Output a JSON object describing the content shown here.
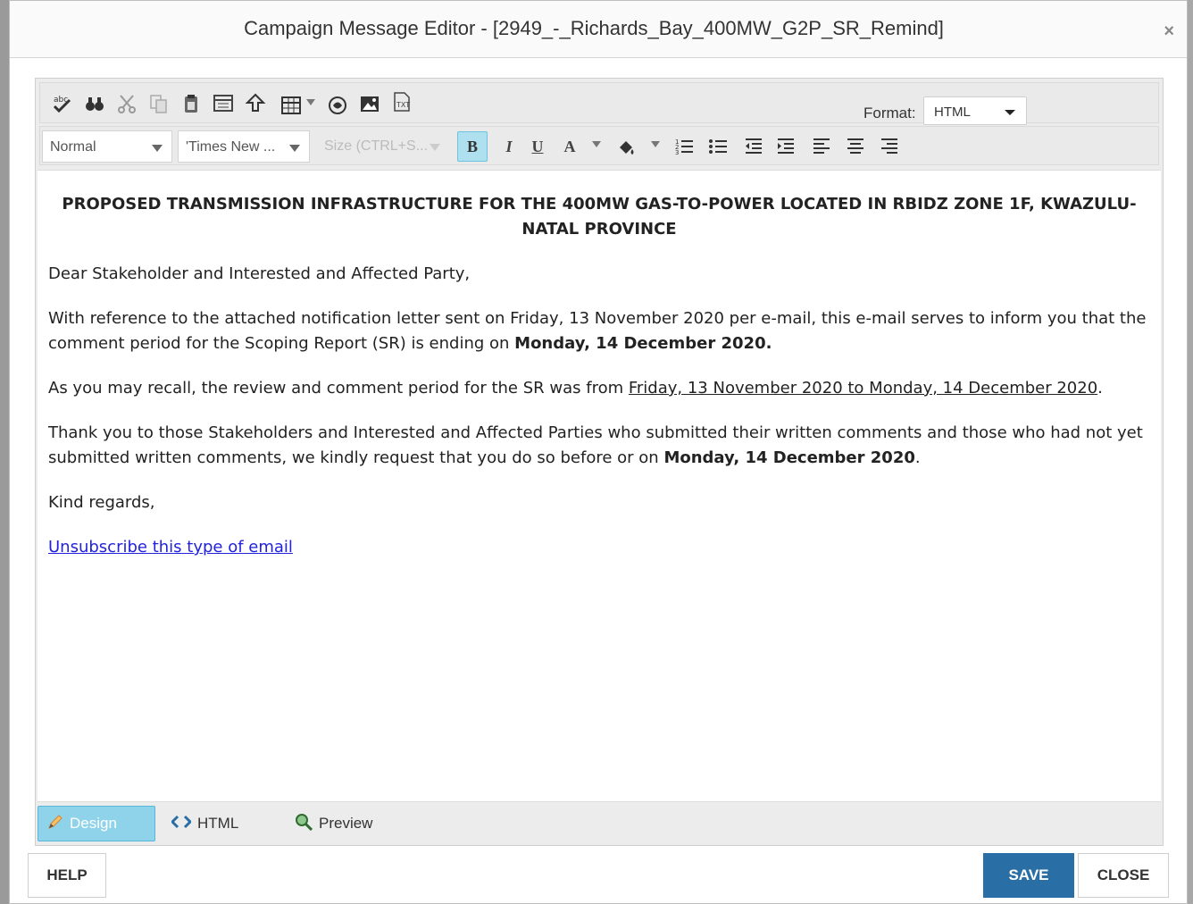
{
  "dialog": {
    "title": "Campaign Message Editor - [2949_-_Richards_Bay_400MW_G2P_SR_Remind]",
    "close_glyph": "×"
  },
  "toolbar": {
    "icons_row1": [
      "spellcheck-icon",
      "find-icon",
      "cut-icon",
      "copy-icon",
      "paste-icon",
      "template-icon",
      "insert-symbol-icon",
      "table-icon",
      "table-dropdown-icon",
      "link-icon",
      "image-icon",
      "document-icon"
    ],
    "format_label": "Format:",
    "format_value": "HTML",
    "paragraph_style": "Normal",
    "font_name": "'Times New ...",
    "font_size": "Size (CTRL+S...",
    "bold": "B",
    "italic": "I",
    "underline": "U",
    "font_color": "A",
    "highlight": "⟴"
  },
  "content": {
    "heading": "PROPOSED TRANSMISSION INFRASTRUCTURE FOR THE 400MW GAS-TO-POWER LOCATED IN RBIDZ ZONE 1F, KWAZULU-NATAL PROVINCE",
    "greeting": "Dear Stakeholder and Interested and Affected Party,",
    "p1_text": "With reference to the attached notification letter sent on Friday, 13 November 2020 per e-mail, this e-mail serves to inform you that the comment period for the Scoping Report (SR) is ending on ",
    "p1_bold": "Monday, 14 December 2020.",
    "p2_text": "As you may recall, the review and comment period for the SR was from ",
    "p2_underlined": "Friday, 13 November 2020 to Monday, 14 December 2020",
    "p2_end": ".",
    "p3_text": "Thank you to those Stakeholders and Interested and Affected Parties who submitted their written comments and those who had not yet submitted written comments, we kindly request that you do so before or on ",
    "p3_bold": "Monday, 14 December 2020",
    "p3_end": ".",
    "closing": "Kind regards,",
    "unsubscribe": "Unsubscribe this type of email"
  },
  "modes": {
    "design": "Design",
    "html": "HTML",
    "preview": "Preview"
  },
  "footer": {
    "help": "HELP",
    "save": "SAVE",
    "close": "CLOSE"
  },
  "colors": {
    "accent": "#2a6ea6",
    "active_tab": "#8fd3ea",
    "link": "#2222dd"
  }
}
